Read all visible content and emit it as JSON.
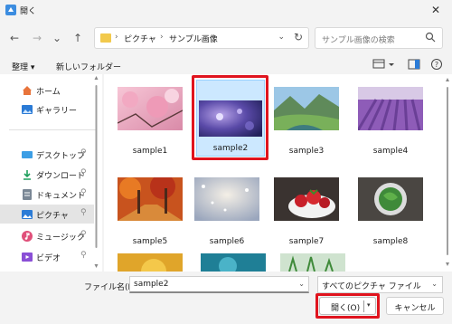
{
  "window": {
    "title": "開く",
    "close_glyph": "✕"
  },
  "nav": {
    "back_glyph": "←",
    "forward_glyph": "→",
    "recent_glyph": "⌄",
    "up_glyph": "↑",
    "breadcrumbs": [
      "ピクチャ",
      "サンプル画像"
    ],
    "crumb_sep": "›",
    "address_dropdown_glyph": "⌄",
    "refresh_glyph": "↻"
  },
  "search": {
    "placeholder": "サンプル画像の検索"
  },
  "toolbar": {
    "organize_label": "整理 ▾",
    "new_folder_label": "新しいフォルダー"
  },
  "sidebar": {
    "items": [
      {
        "label": "ホーム",
        "icon": "home-icon",
        "color": "#e8743b",
        "pinned": false
      },
      {
        "label": "ギャラリー",
        "icon": "gallery-icon",
        "color": "#2b7bd6",
        "pinned": false
      },
      {
        "label": "デスクトップ",
        "icon": "desktop-icon",
        "color": "#3c9ee5",
        "pinned": true
      },
      {
        "label": "ダウンロード",
        "icon": "download-icon",
        "color": "#1e9e5c",
        "pinned": true
      },
      {
        "label": "ドキュメント",
        "icon": "documents-icon",
        "color": "#7a8795",
        "pinned": true
      },
      {
        "label": "ピクチャ",
        "icon": "pictures-icon",
        "color": "#2b7bd6",
        "pinned": true
      },
      {
        "label": "ミュージック",
        "icon": "music-icon",
        "color": "#e0507a",
        "pinned": true
      },
      {
        "label": "ビデオ",
        "icon": "videos-icon",
        "color": "#8a4fd6",
        "pinned": true
      }
    ],
    "pin_glyph": "📌"
  },
  "files": [
    {
      "name": "sample1",
      "icon": "cherry-blossom-image"
    },
    {
      "name": "sample2",
      "icon": "purple-bokeh-image",
      "selected": true
    },
    {
      "name": "sample3",
      "icon": "mountain-landscape-image"
    },
    {
      "name": "sample4",
      "icon": "lavender-field-image"
    },
    {
      "name": "sample5",
      "icon": "autumn-forest-image"
    },
    {
      "name": "sample6",
      "icon": "snowy-light-image"
    },
    {
      "name": "sample7",
      "icon": "strawberries-image"
    },
    {
      "name": "sample8",
      "icon": "basil-bowl-image"
    }
  ],
  "bottom": {
    "filename_label": "ファイル名(N):",
    "filename_value": "sample2",
    "filter_value": "すべてのピクチャ ファイル",
    "dropdown_glyph": "⌄",
    "open_label": "開く(O)",
    "open_split_glyph": "▾",
    "cancel_label": "キャンセル"
  },
  "colors": {
    "highlight_red": "#e0141e",
    "selection_blue": "#cce8ff"
  }
}
